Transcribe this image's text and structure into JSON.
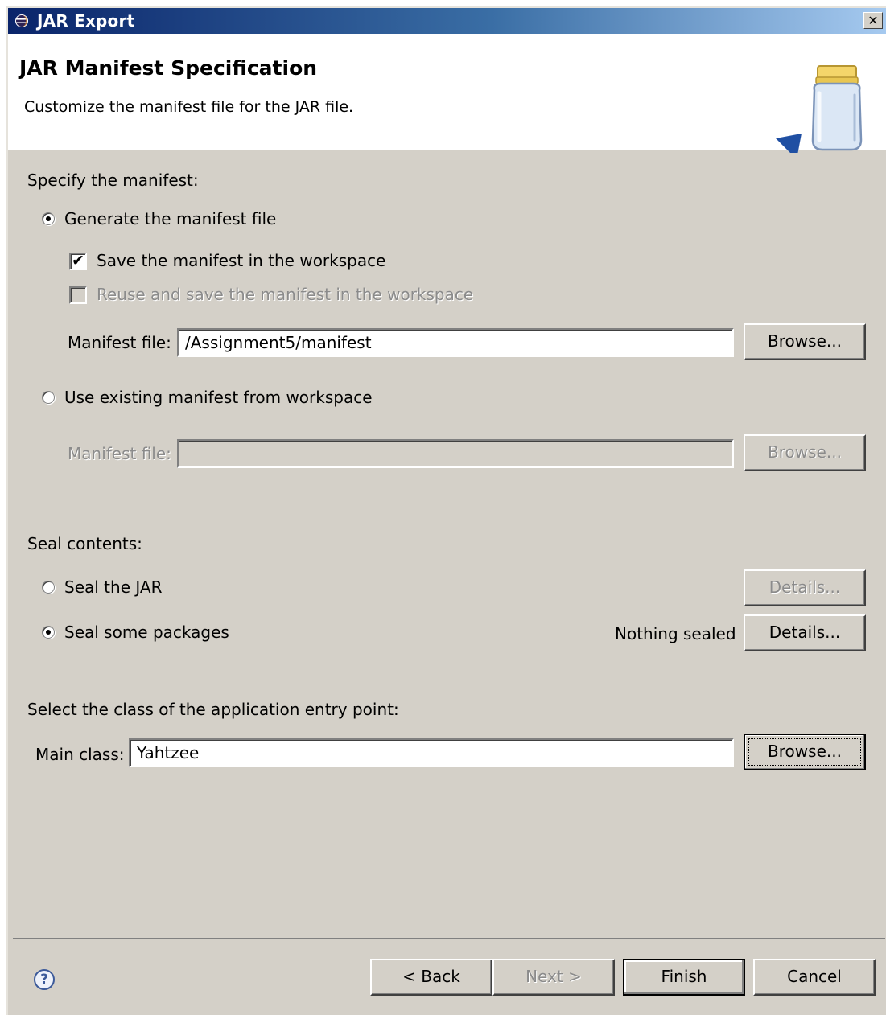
{
  "window": {
    "title": "JAR Export"
  },
  "header": {
    "title": "JAR Manifest Specification",
    "description": "Customize the manifest file for the JAR file."
  },
  "manifest": {
    "section_label": "Specify the manifest:",
    "generate_radio_label": "Generate the manifest file",
    "generate_selected": true,
    "save_checkbox_label": "Save the manifest in the workspace",
    "save_checked": true,
    "reuse_checkbox_label": "Reuse and save the manifest in the workspace",
    "reuse_checked": false,
    "manifest_file_label": "Manifest file:",
    "manifest_file_value": "/Assignment5/manifest",
    "browse_label": "Browse...",
    "use_existing_radio_label": "Use existing manifest from workspace",
    "use_existing_selected": false,
    "existing_manifest_label": "Manifest file:",
    "existing_manifest_value": "",
    "existing_browse_label": "Browse..."
  },
  "seal": {
    "section_label": "Seal contents:",
    "seal_jar_label": "Seal the JAR",
    "seal_jar_selected": false,
    "seal_jar_details_label": "Details...",
    "seal_packages_label": "Seal some packages",
    "seal_packages_selected": true,
    "status_text": "Nothing sealed",
    "seal_packages_details_label": "Details..."
  },
  "entry_point": {
    "section_label": "Select the class of the application entry point:",
    "main_class_label": "Main class:",
    "main_class_value": "Yahtzee",
    "browse_label": "Browse..."
  },
  "footer": {
    "help_icon": "help-icon",
    "back_label": "< Back",
    "next_label": "Next >",
    "finish_label": "Finish",
    "cancel_label": "Cancel"
  },
  "icons": {
    "title_icon": "eclipse-icon",
    "close_icon": "close-icon",
    "banner_icon": "jar-icon"
  },
  "colors": {
    "titlebar_start": "#0a246a",
    "titlebar_end": "#a6caf0",
    "dialog_background": "#d4d0c8",
    "disabled_text": "#8b8b8b"
  }
}
